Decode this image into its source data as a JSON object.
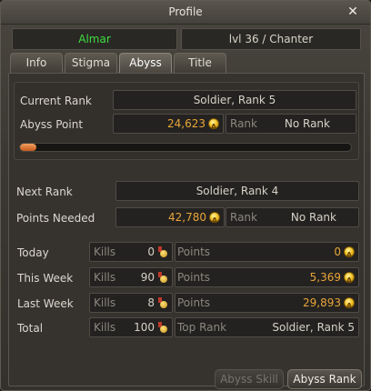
{
  "window": {
    "title": "Profile"
  },
  "character": {
    "name": "Almar",
    "level_class": "lvl 36 / Chanter"
  },
  "tabs": [
    {
      "label": "Info",
      "active": false
    },
    {
      "label": "Stigma",
      "active": false
    },
    {
      "label": "Abyss",
      "active": true
    },
    {
      "label": "Title",
      "active": false
    }
  ],
  "current": {
    "rank_label": "Current Rank",
    "rank_value": "Soldier, Rank 5",
    "points_label": "Abyss Point",
    "points_value": "24,623",
    "rank_sub_label": "Rank",
    "rank_sub_value": "No Rank",
    "progress_fraction": 0.05
  },
  "next": {
    "rank_label": "Next Rank",
    "rank_value": "Soldier, Rank 4",
    "points_label": "Points Needed",
    "points_value": "42,780",
    "rank_sub_label": "Rank",
    "rank_sub_value": "No Rank"
  },
  "stats": {
    "kills_label": "Kills",
    "points_label": "Points",
    "top_rank_label": "Top Rank",
    "rows": [
      {
        "label": "Today",
        "kills": "0",
        "points": "0"
      },
      {
        "label": "This Week",
        "kills": "90",
        "points": "5,369"
      },
      {
        "label": "Last Week",
        "kills": "8",
        "points": "29,893"
      }
    ],
    "total": {
      "label": "Total",
      "kills": "100",
      "top_rank": "Soldier, Rank 5"
    }
  },
  "buttons": {
    "abyss_skill": "Abyss Skill",
    "abyss_rank": "Abyss Rank"
  },
  "colors": {
    "name": "#3fdc3f",
    "points": "#e8a53a",
    "progress": "#c65a1c"
  },
  "icons": {
    "close": "close-icon",
    "points": "abyss-point-coin-icon",
    "kills": "kill-medal-icon"
  }
}
